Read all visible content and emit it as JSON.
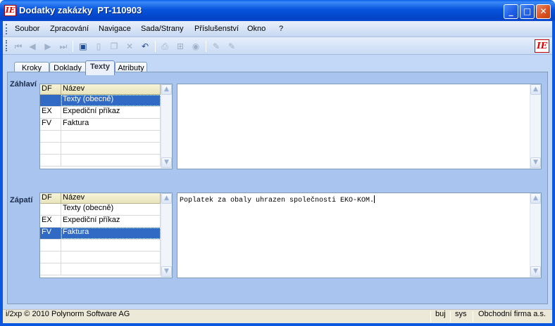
{
  "window": {
    "title": "Dodatky zakázky  PT-110903",
    "minimize_glyph": "_",
    "maximize_glyph": "□",
    "close_glyph": "✕",
    "logo_text": "IE"
  },
  "menu": {
    "items": [
      "Soubor",
      "Zpracování",
      "Navigace",
      "Sada/Strany",
      "Příslušenství",
      "Okno",
      "?"
    ]
  },
  "toolbar": {
    "icons": [
      "first-record-icon",
      "previous-record-icon",
      "next-record-icon",
      "last-record-icon",
      "save-icon",
      "new-icon",
      "copy-icon",
      "delete-icon",
      "undo-icon",
      "print-icon",
      "tree-icon",
      "stop-icon",
      "edit-icon",
      "edit-alt-icon"
    ],
    "glyphs": {
      "first": "⏮",
      "prev": "◀",
      "next": "▶",
      "last": "⏭",
      "save": "▣",
      "new": "▯",
      "copy": "❐",
      "delete": "✕",
      "undo": "↶",
      "print": "⎙",
      "tree": "⊞",
      "stop": "◉",
      "edit": "✎",
      "edit2": "✎"
    }
  },
  "tabs": [
    {
      "label": "Kroky",
      "active": false
    },
    {
      "label": "Doklady",
      "active": false
    },
    {
      "label": "Texty",
      "active": true
    },
    {
      "label": "Atributy",
      "active": false
    }
  ],
  "header_section": {
    "label": "Záhlaví",
    "columns": [
      "DF",
      "Název"
    ],
    "rows": [
      {
        "df": "",
        "name": "Texty (obecně)",
        "selected": true
      },
      {
        "df": "EX",
        "name": "Expediční příkaz",
        "selected": false
      },
      {
        "df": "FV",
        "name": "Faktura",
        "selected": false
      }
    ],
    "text": ""
  },
  "footer_section": {
    "label": "Zápatí",
    "columns": [
      "DF",
      "Název"
    ],
    "rows": [
      {
        "df": "",
        "name": "Texty (obecně)",
        "selected": false
      },
      {
        "df": "EX",
        "name": "Expediční příkaz",
        "selected": false
      },
      {
        "df": "FV",
        "name": "Faktura",
        "selected": true
      }
    ],
    "text": "Poplatek za obaly uhrazen společnosti EKO-KOM."
  },
  "scroll": {
    "up": "▲",
    "down": "▼"
  },
  "statusbar": {
    "copyright": "i/2xp © 2010 Polynorm Software AG",
    "user": "buj",
    "system": "sys",
    "company": "Obchodní firma a.s."
  },
  "colors": {
    "selection": "#316ac5",
    "titlebar": "#0a58e0"
  }
}
